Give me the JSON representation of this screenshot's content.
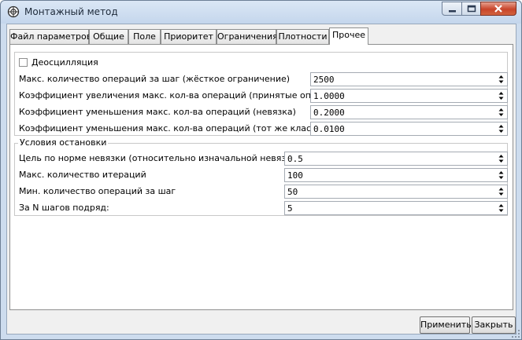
{
  "window": {
    "title": "Монтажный метод",
    "icons": {
      "app": "gear-app-icon",
      "minimize": "minimize-icon",
      "maximize": "maximize-icon",
      "close": "close-icon"
    }
  },
  "tabs": [
    {
      "label": "Файл параметров"
    },
    {
      "label": "Общие"
    },
    {
      "label": "Поле"
    },
    {
      "label": "Приоритет"
    },
    {
      "label": "Ограничения"
    },
    {
      "label": "Плотности"
    },
    {
      "label": "Прочее"
    }
  ],
  "active_tab": "Прочее",
  "deoscillation": {
    "label": "Деосцилляция",
    "checked": false
  },
  "settings": [
    {
      "label": "Макс. количество операций за шаг (жёсткое ограничение)",
      "value": "2500"
    },
    {
      "label": "Коэффициент увеличения макс. кол-ва операций (принятые операции)",
      "value": "1.0000"
    },
    {
      "label": "Коэффициент уменьшения макс. кол-ва операций (невязка)",
      "value": "0.2000"
    },
    {
      "label": "Коэффициент уменьшения макс. кол-ва операций (тот же класс)",
      "value": "0.0100"
    }
  ],
  "stop": {
    "title": "Условия остановки",
    "items": [
      {
        "label": "Цель по норме невязки (относительно изначальной невязки), %",
        "value": "0.5"
      },
      {
        "label": "Макс. количество итераций",
        "value": "100"
      },
      {
        "label": "Мин. количество операций за шаг",
        "value": "50"
      },
      {
        "label": "За N шагов подряд:",
        "value": "5"
      }
    ]
  },
  "buttons": {
    "apply": "Применить",
    "close": "Закрыть"
  },
  "colors": {
    "titlebar": "#c4d6ec",
    "close_button": "#c8442a",
    "panel": "#ffffff",
    "client": "#f0f0f0"
  }
}
